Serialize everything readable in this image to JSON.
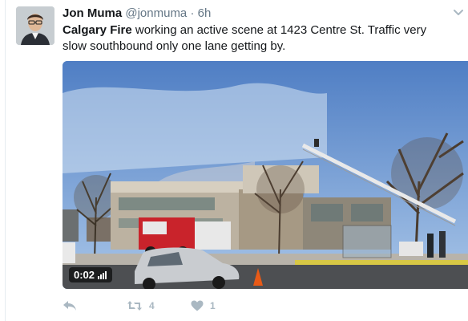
{
  "tweet": {
    "author_name": "Jon Muma",
    "handle": "@jonmuma",
    "separator": "·",
    "time": "6h",
    "mention": "Calgary Fire",
    "text": " working an active scene at 1423 Centre St. Traffic very slow southbound only one lane getting by."
  },
  "media": {
    "duration": "0:02"
  },
  "actions": {
    "retweet_count": "4",
    "like_count": "1"
  },
  "colors": {
    "text": "#14171a",
    "meta": "#657786",
    "action_icon": "#aab8c2",
    "divider": "#e6ecf0"
  },
  "icons": [
    "chevron-down-icon",
    "reply-icon",
    "retweet-icon",
    "heart-icon",
    "volume-icon"
  ]
}
